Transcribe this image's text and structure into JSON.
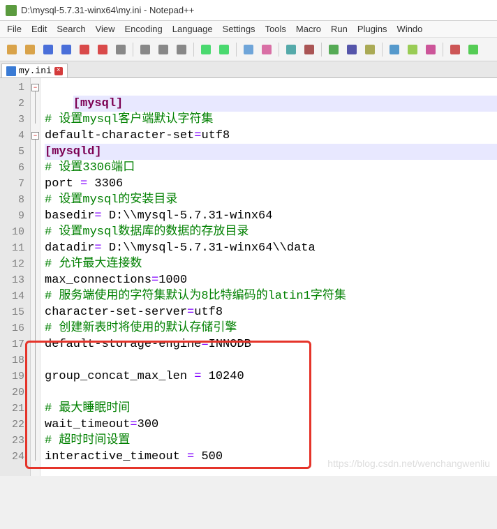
{
  "window": {
    "title": "D:\\mysql-5.7.31-winx64\\my.ini - Notepad++"
  },
  "menu": {
    "items": [
      "File",
      "Edit",
      "Search",
      "View",
      "Encoding",
      "Language",
      "Settings",
      "Tools",
      "Macro",
      "Run",
      "Plugins",
      "Windo"
    ]
  },
  "tab": {
    "filename": "my.ini"
  },
  "code": {
    "lines": [
      {
        "n": 1,
        "type": "section",
        "open": "[",
        "name": "mysql",
        "close": "]"
      },
      {
        "n": 2,
        "type": "comment",
        "text": "# 设置mysql客户端默认字符集"
      },
      {
        "n": 3,
        "type": "kv",
        "key": "default-character-set",
        "op": "=",
        "val": "utf8"
      },
      {
        "n": 4,
        "type": "section",
        "open": "[",
        "name": "mysqld",
        "close": "]"
      },
      {
        "n": 5,
        "type": "comment",
        "text": "# 设置3306端口"
      },
      {
        "n": 6,
        "type": "kv",
        "key": "port ",
        "op": "=",
        "val": " 3306"
      },
      {
        "n": 7,
        "type": "comment",
        "text": "# 设置mysql的安装目录"
      },
      {
        "n": 8,
        "type": "kv",
        "key": "basedir",
        "op": "=",
        "val": " D:\\\\mysql-5.7.31-winx64"
      },
      {
        "n": 9,
        "type": "comment",
        "text": "# 设置mysql数据库的数据的存放目录"
      },
      {
        "n": 10,
        "type": "kv",
        "key": "datadir",
        "op": "=",
        "val": " D:\\\\mysql-5.7.31-winx64\\\\data"
      },
      {
        "n": 11,
        "type": "comment",
        "text": "# 允许最大连接数"
      },
      {
        "n": 12,
        "type": "kv",
        "key": "max_connections",
        "op": "=",
        "val": "1000"
      },
      {
        "n": 13,
        "type": "comment",
        "text": "# 服务端使用的字符集默认为8比特编码的latin1字符集"
      },
      {
        "n": 14,
        "type": "kv",
        "key": "character-set-server",
        "op": "=",
        "val": "utf8"
      },
      {
        "n": 15,
        "type": "comment",
        "text": "# 创建新表时将使用的默认存储引擎"
      },
      {
        "n": 16,
        "type": "kv",
        "key": "default-storage-engine",
        "op": "=",
        "val": "INNODB"
      },
      {
        "n": 17,
        "type": "blank",
        "text": ""
      },
      {
        "n": 18,
        "type": "kv",
        "key": "group_concat_max_len ",
        "op": "=",
        "val": " 10240"
      },
      {
        "n": 19,
        "type": "blank",
        "text": ""
      },
      {
        "n": 20,
        "type": "comment",
        "text": "# 最大睡眠时间"
      },
      {
        "n": 21,
        "type": "kv",
        "key": "wait_timeout",
        "op": "=",
        "val": "300"
      },
      {
        "n": 22,
        "type": "comment",
        "text": "# 超时时间设置"
      },
      {
        "n": 23,
        "type": "kv",
        "key": "interactive_timeout ",
        "op": "=",
        "val": " 500"
      },
      {
        "n": 24,
        "type": "blank",
        "text": ""
      }
    ]
  },
  "highlight_box": {
    "from_line": 17,
    "to_line": 24
  },
  "watermark": "https://blog.csdn.net/wenchangwenliu",
  "toolbar_icons": [
    "new",
    "open",
    "save",
    "save-all",
    "close",
    "close-all",
    "print",
    "",
    "cut",
    "copy",
    "paste",
    "",
    "undo",
    "redo",
    "",
    "find",
    "replace",
    "",
    "zoom-in",
    "zoom-out",
    "",
    "sync",
    "word-wrap",
    "all-chars",
    "",
    "indent-guide",
    "fold",
    "unfold",
    "",
    "macro-rec",
    "macro-play"
  ]
}
